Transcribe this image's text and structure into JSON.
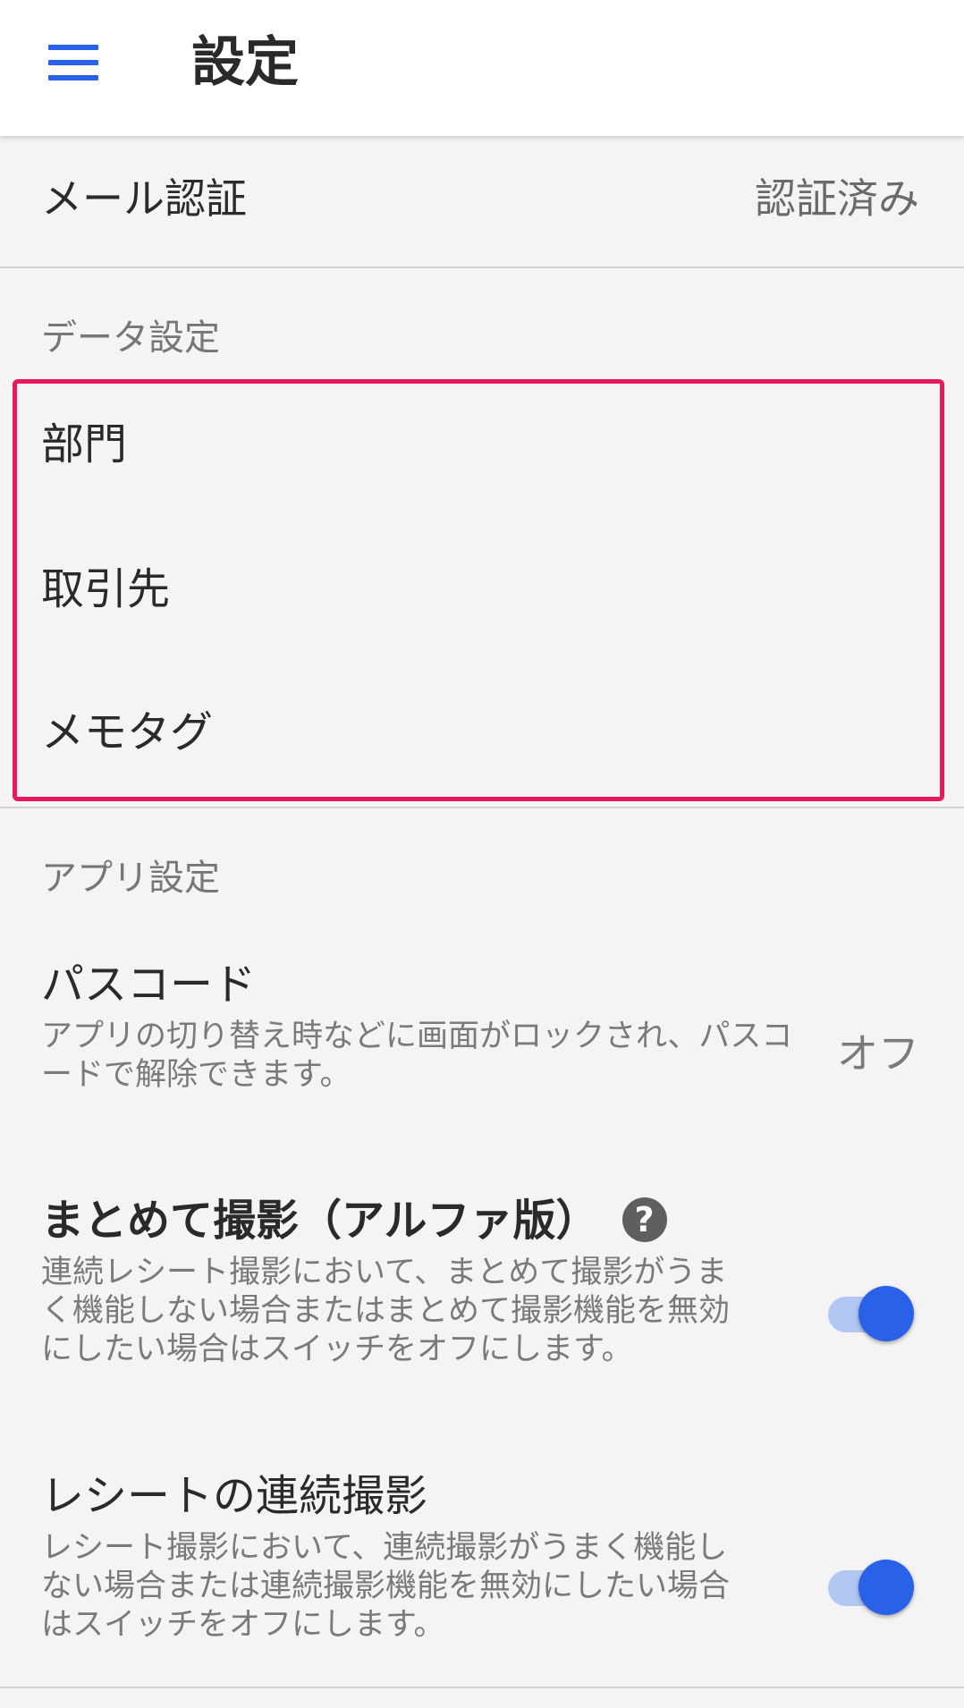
{
  "appbar": {
    "menu_icon": "hamburger-menu-icon",
    "title": "設定",
    "accent_color": "#2962e8"
  },
  "email_auth": {
    "label": "メール認証",
    "status": "認証済み"
  },
  "data_settings": {
    "header": "データ設定",
    "highlight_color": "#e8195c",
    "items": [
      {
        "label": "部門"
      },
      {
        "label": "取引先"
      },
      {
        "label": "メモタグ"
      }
    ]
  },
  "app_settings": {
    "header": "アプリ設定",
    "passcode": {
      "title": "パスコード",
      "description": "アプリの切り替え時などに画面がロックされ、パスコードで解除できます。",
      "value": "オフ"
    },
    "batch_capture": {
      "title": "まとめて撮影（アルファ版）",
      "help_icon": "question-mark-icon",
      "help_glyph": "?",
      "description": "連続レシート撮影において、まとめて撮影がうまく機能しない場合またはまとめて撮影機能を無効にしたい場合はスイッチをオフにします。",
      "enabled": true
    },
    "continuous_capture": {
      "title": "レシートの連続撮影",
      "description": "レシート撮影において、連続撮影がうまく機能しない場合または連続撮影機能を無効にしたい場合はスイッチをオフにします。",
      "enabled": true
    }
  }
}
